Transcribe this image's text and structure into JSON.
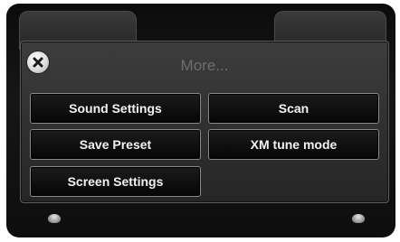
{
  "popup": {
    "title": "More...",
    "close_icon": "close-x-icon"
  },
  "buttons": {
    "sound_settings": "Sound Settings",
    "scan": "Scan",
    "save_preset": "Save Preset",
    "xm_tune_mode": "XM tune mode",
    "screen_settings": "Screen Settings"
  },
  "colors": {
    "screen_bg": "#111111",
    "popup_bg": "#353535",
    "button_bg": "#0a0a0a",
    "button_border": "#8a8a8a",
    "title_text": "#6e6e6e"
  }
}
